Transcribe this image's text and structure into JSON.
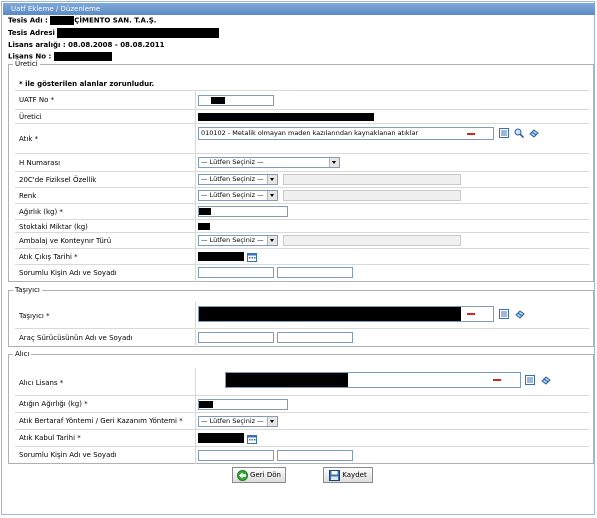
{
  "window": {
    "title": "Uatf Ekleme / Düzenleme"
  },
  "facility": {
    "name_label": "Tesis Adı :",
    "name_value": "ÇİMENTO SAN. T.A.Ş.",
    "address_label": "Tesis Adresi",
    "license_range_label": "Lisans aralığı :",
    "license_range_value": "08.08.2008 - 08.08.2011",
    "license_no_label": "Lisans No :"
  },
  "producer": {
    "legend": "Üretici",
    "required_note": "* ile gösterilen alanlar zorunludur.",
    "uatf_no_label": "UATF No *",
    "producer_label": "Üretici",
    "waste_label": "Atık *",
    "waste_value": "010102 - Metalik olmayan maden kazılarından kaynaklanan atıklar",
    "h_number_label": "H Numarası",
    "physical_label": "20C'de Fiziksel Özellik",
    "color_label": "Renk",
    "weight_label": "Ağırlık (kg) *",
    "stock_label": "Stoktaki Miktar (kg)",
    "packaging_label": "Ambalaj ve Konteynır Türü",
    "exit_date_label": "Atık Çıkış Tarihi *",
    "responsible_label": "Sorumlu Kişin Adı ve Soyadı"
  },
  "carrier": {
    "legend": "Taşıyıcı",
    "carrier_label": "Taşıyıcı *",
    "driver_label": "Araç Sürücüsünün Adı ve Soyadı"
  },
  "receiver": {
    "legend": "Alıcı",
    "license_label": "Alıcı Lisans *",
    "received_weight_label": "Atığın Ağırlığı (kg) *",
    "disposal_label": "Atık Bertaraf Yöntemi / Geri Kazanım Yöntemi *",
    "accept_date_label": "Atık Kabul Tarihi *",
    "responsible_label": "Sorumlu Kişin Adı ve Soyadı"
  },
  "select_placeholder": "— Lütfen Seçiniz —",
  "buttons": {
    "back": "Geri Dön",
    "save": "Kaydet"
  },
  "icons": {
    "list": "list-icon",
    "search": "search-icon",
    "eraser": "eraser-icon",
    "calendar": "calendar-icon",
    "remove": "remove-icon",
    "back": "back-arrow-icon",
    "save": "floppy-icon"
  },
  "colors": {
    "title_bar": "#6b97cc",
    "remove": "#d9261c",
    "border": "#7f9db9"
  }
}
